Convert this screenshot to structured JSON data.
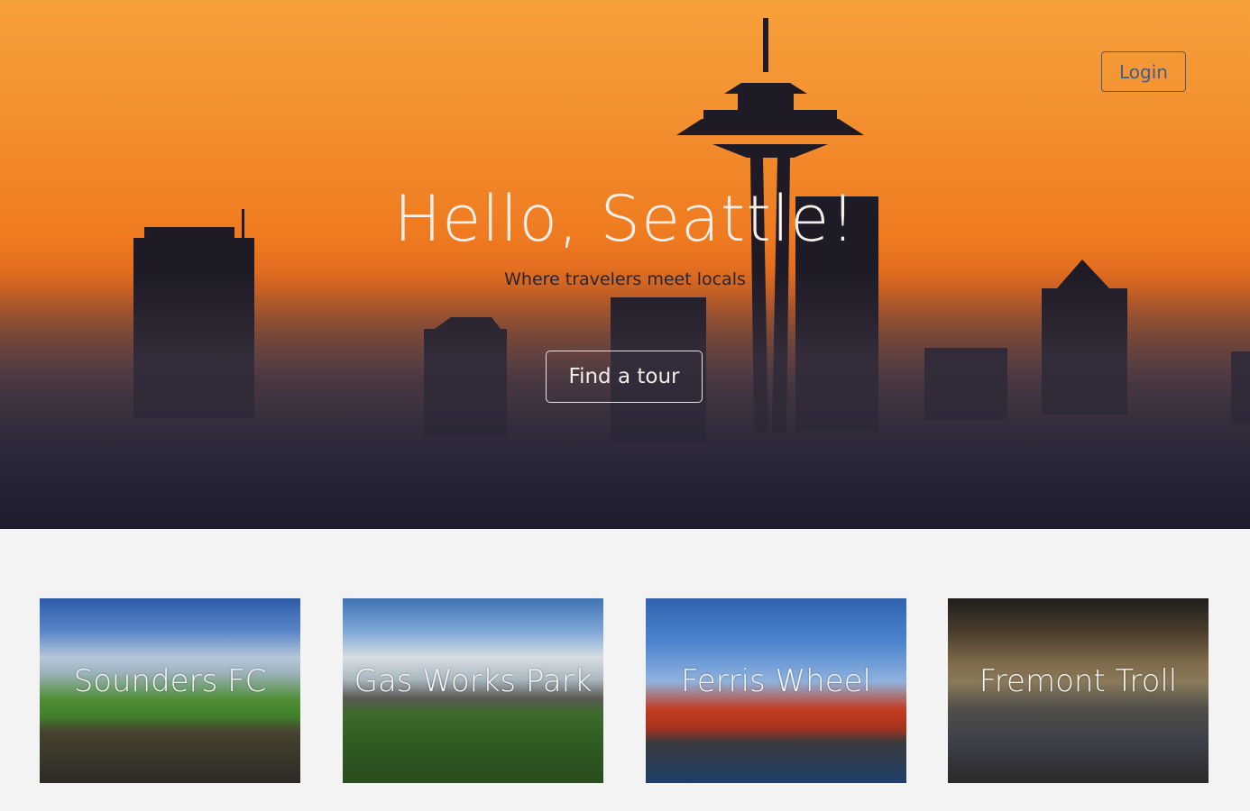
{
  "header": {
    "login_label": "Login"
  },
  "hero": {
    "title": "Hello, Seattle!",
    "subtitle": "Where travelers meet locals",
    "cta_label": "Find a tour"
  },
  "tiles": [
    {
      "label": "Sounders FC"
    },
    {
      "label": "Gas Works Park"
    },
    {
      "label": "Ferris Wheel"
    },
    {
      "label": "Fremont Troll"
    }
  ],
  "colors": {
    "hero_orange": "#ef7a20",
    "login_border": "#3d5f8a",
    "page_bg": "#f3f3f3"
  }
}
